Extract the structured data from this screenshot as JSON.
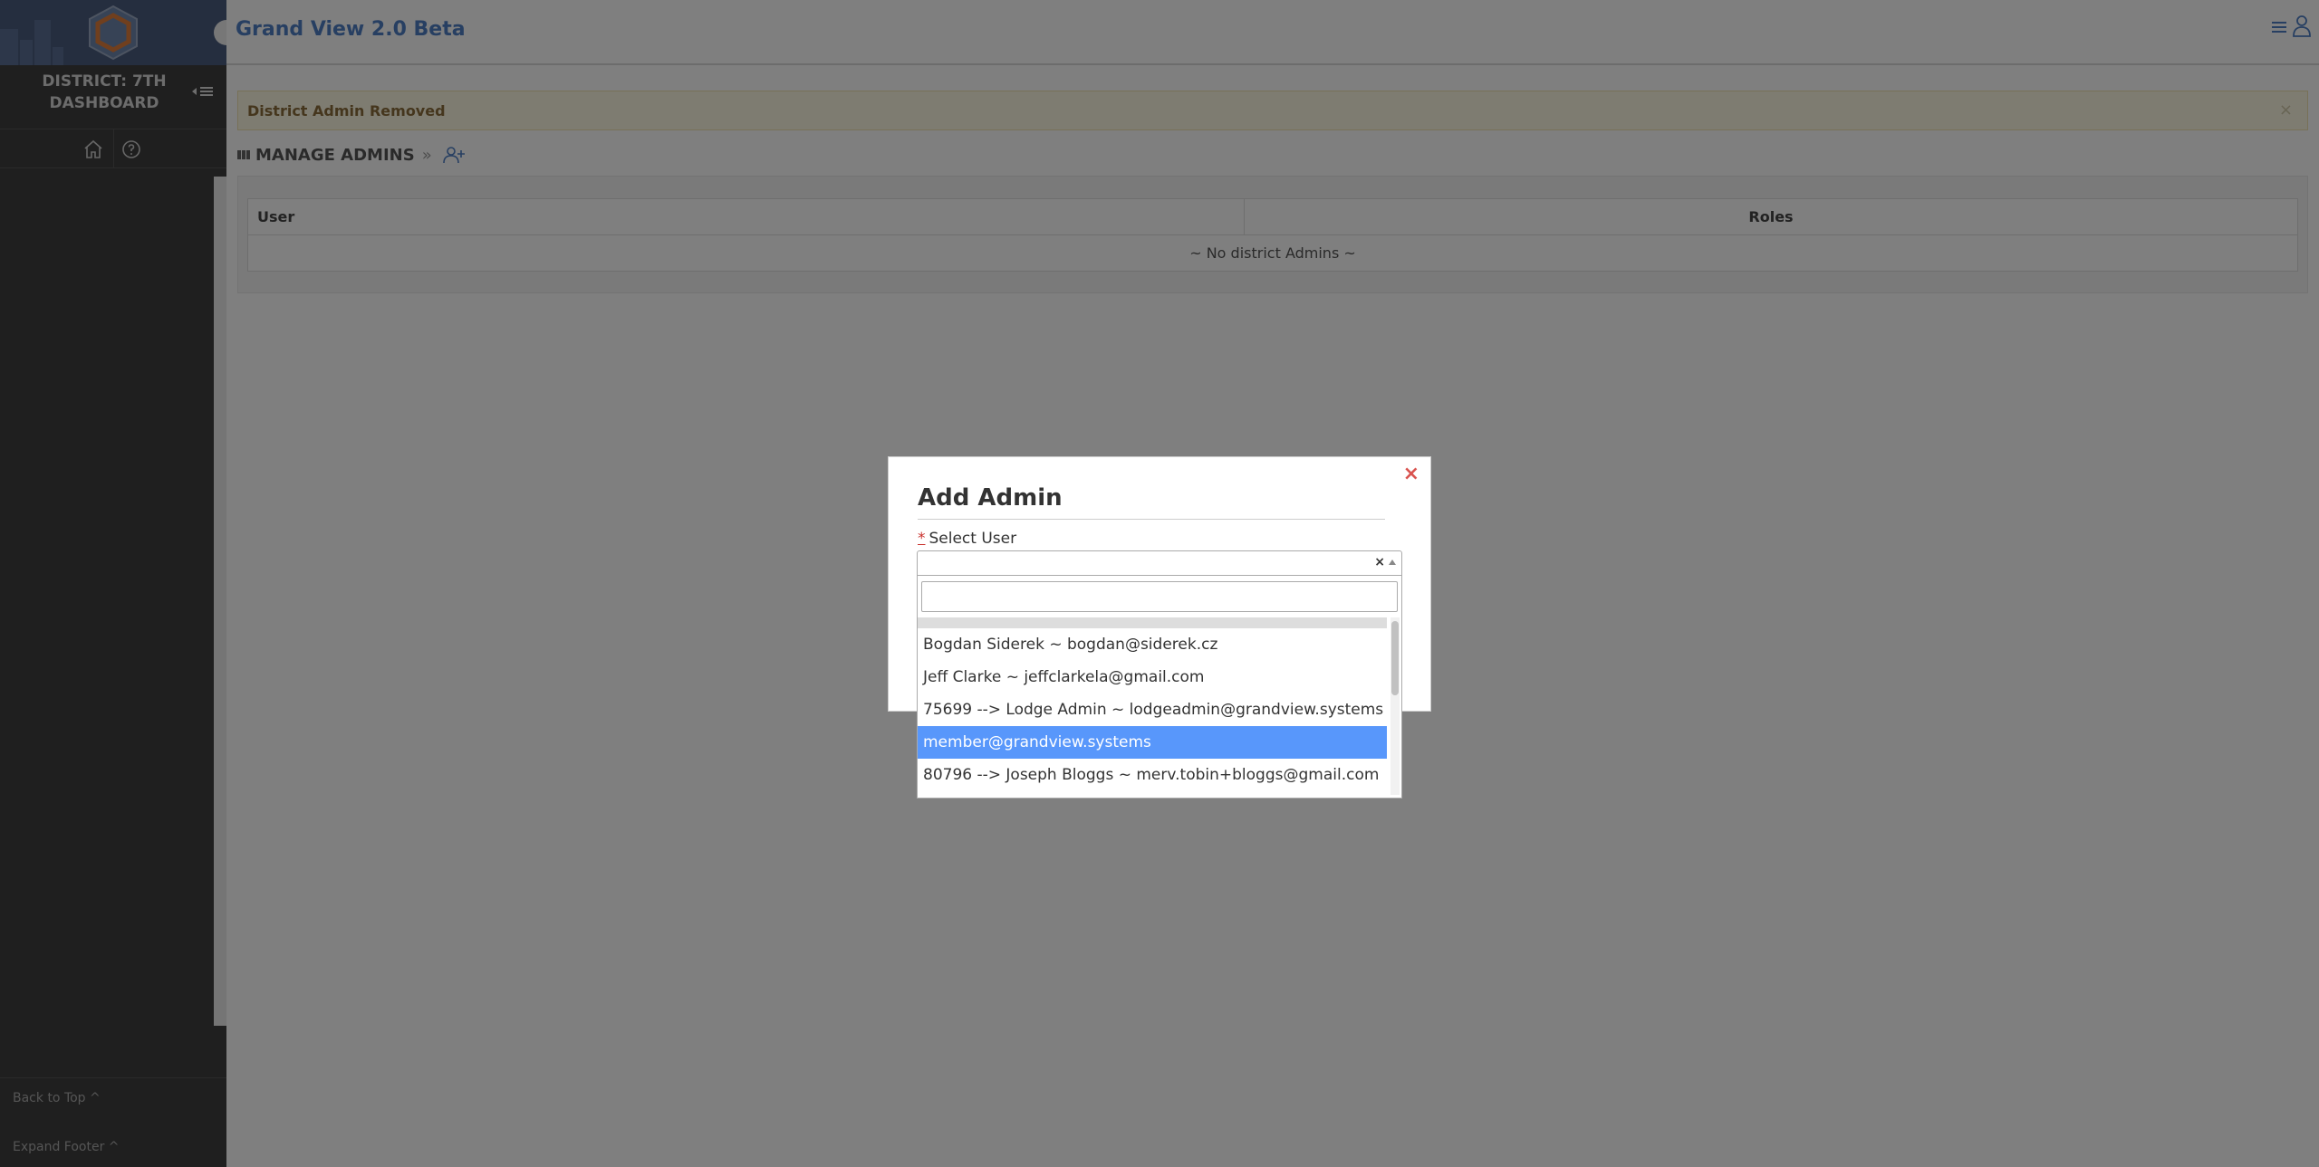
{
  "app": {
    "title": "Grand View 2.0 Beta"
  },
  "sidebar": {
    "district_line1": "DISTRICT: 7TH",
    "district_line2": "DASHBOARD",
    "back_to_top": "Back to Top ^",
    "expand_footer": "Expand Footer ^"
  },
  "alert": {
    "message": "District Admin Removed",
    "close": "×"
  },
  "breadcrumb": {
    "title": "MANAGE ADMINS",
    "separator": "»"
  },
  "table": {
    "columns": [
      "User",
      "Roles"
    ],
    "empty_message": "~ No district Admins ~"
  },
  "modal": {
    "title": "Add Admin",
    "close": "×",
    "required_mark": "*",
    "field_label": "Select User",
    "clear_glyph": "×",
    "search_value": "",
    "options": [
      "Bogdan Siderek ~ bogdan@siderek.cz",
      "Jeff Clarke ~ jeffclarkela@gmail.com",
      "75699 --> Lodge Admin ~ lodgeadmin@grandview.systems",
      "member@grandview.systems",
      "80796 --> Joseph Bloggs ~ merv.tobin+bloggs@gmail.com"
    ],
    "highlighted_option": "member@grandview.systems"
  },
  "colors": {
    "accent": "#4f7fc4",
    "highlight": "#5897fb",
    "alert_text": "#8a6d3b",
    "close_red": "#d9534f"
  }
}
